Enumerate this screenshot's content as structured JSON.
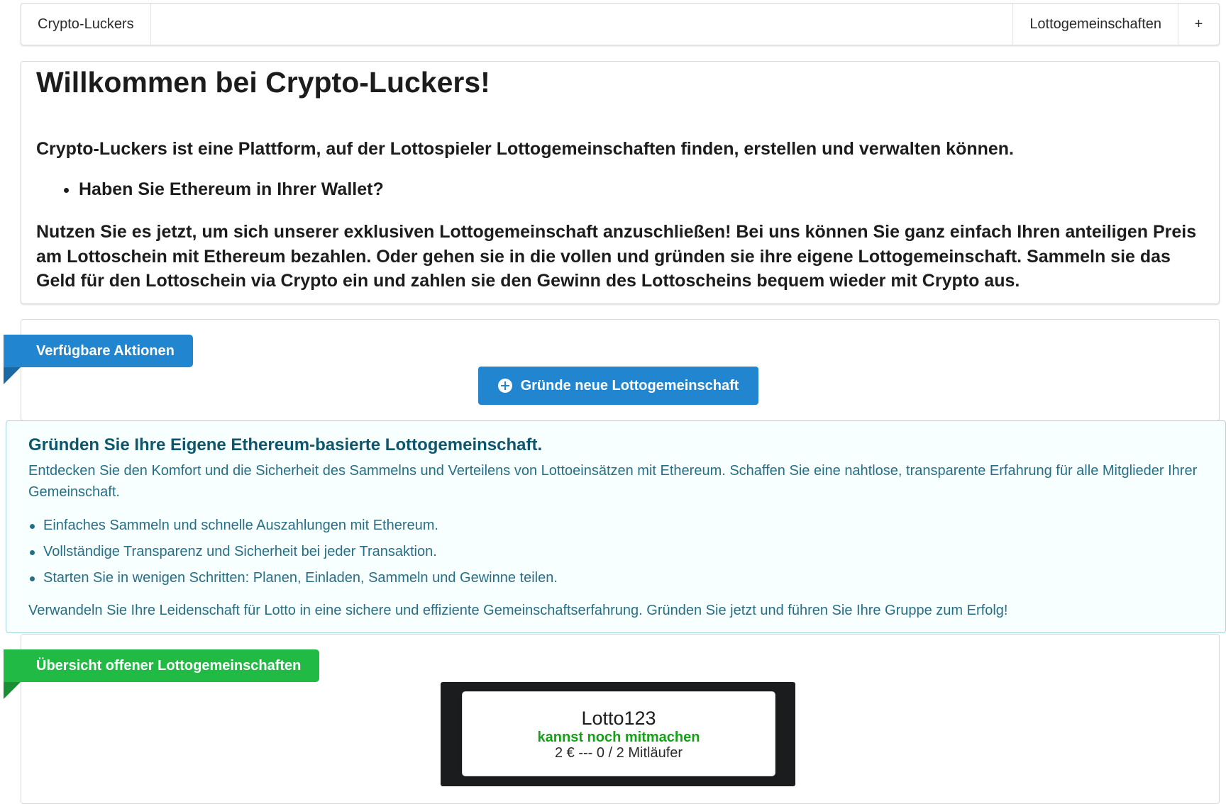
{
  "topmenu": {
    "brand": "Crypto-Luckers",
    "nav_link": "Lottogemeinschaften",
    "add_label": "+"
  },
  "welcome": {
    "title": "Willkommen bei Crypto-Luckers!",
    "intro": "Crypto-Luckers ist eine Plattform, auf der Lottospieler Lottogemeinschaften finden, erstellen und verwalten können.",
    "bullets": [
      "Haben Sie Ethereum in Ihrer Wallet?"
    ],
    "body": "Nutzen Sie es jetzt, um sich unserer exklusiven Lottogemeinschaft anzuschließen! Bei uns können Sie ganz einfach Ihren anteiligen Preis am Lottoschein mit Ethereum bezahlen. Oder gehen sie in die vollen und gründen sie ihre eigene Lottogemeinschaft. Sammeln sie das Geld für den Lottoschein via Crypto ein und zahlen sie den Gewinn des Lottoscheins bequem wieder mit Crypto aus."
  },
  "actions": {
    "ribbon": "Verfügbare Aktionen",
    "create_button": "Gründe neue Lottogemeinschaft",
    "create_icon": "plus-circle-icon"
  },
  "info": {
    "header": "Gründen Sie Ihre Eigene Ethereum-basierte Lottogemeinschaft.",
    "description": "Entdecken Sie den Komfort und die Sicherheit des Sammelns und Verteilens von Lottoeinsätzen mit Ethereum. Schaffen Sie eine nahtlose, transparente Erfahrung für alle Mitglieder Ihrer Gemeinschaft.",
    "points": [
      "Einfaches Sammeln und schnelle Auszahlungen mit Ethereum.",
      "Vollständige Transparenz und Sicherheit bei jeder Transaktion.",
      "Starten Sie in wenigen Schritten: Planen, Einladen, Sammeln und Gewinne teilen."
    ],
    "footer": "Verwandeln Sie Ihre Leidenschaft für Lotto in eine sichere und effiziente Gemeinschaftserfahrung. Gründen Sie jetzt und führen Sie Ihre Gruppe zum Erfolg!"
  },
  "overview": {
    "ribbon": "Übersicht offener Lottogemeinschaften",
    "cards": [
      {
        "name": "Lotto123",
        "status": "kannst noch mitmachen",
        "meta": "2 € --- 0 / 2 Mitläufer"
      }
    ]
  },
  "colors": {
    "primary_blue": "#2185d0",
    "ribbon_green": "#21ba45",
    "info_text": "#276f86",
    "info_background": "#f8ffff",
    "status_green": "#16a01a",
    "card_frame": "#1b1c1d"
  }
}
